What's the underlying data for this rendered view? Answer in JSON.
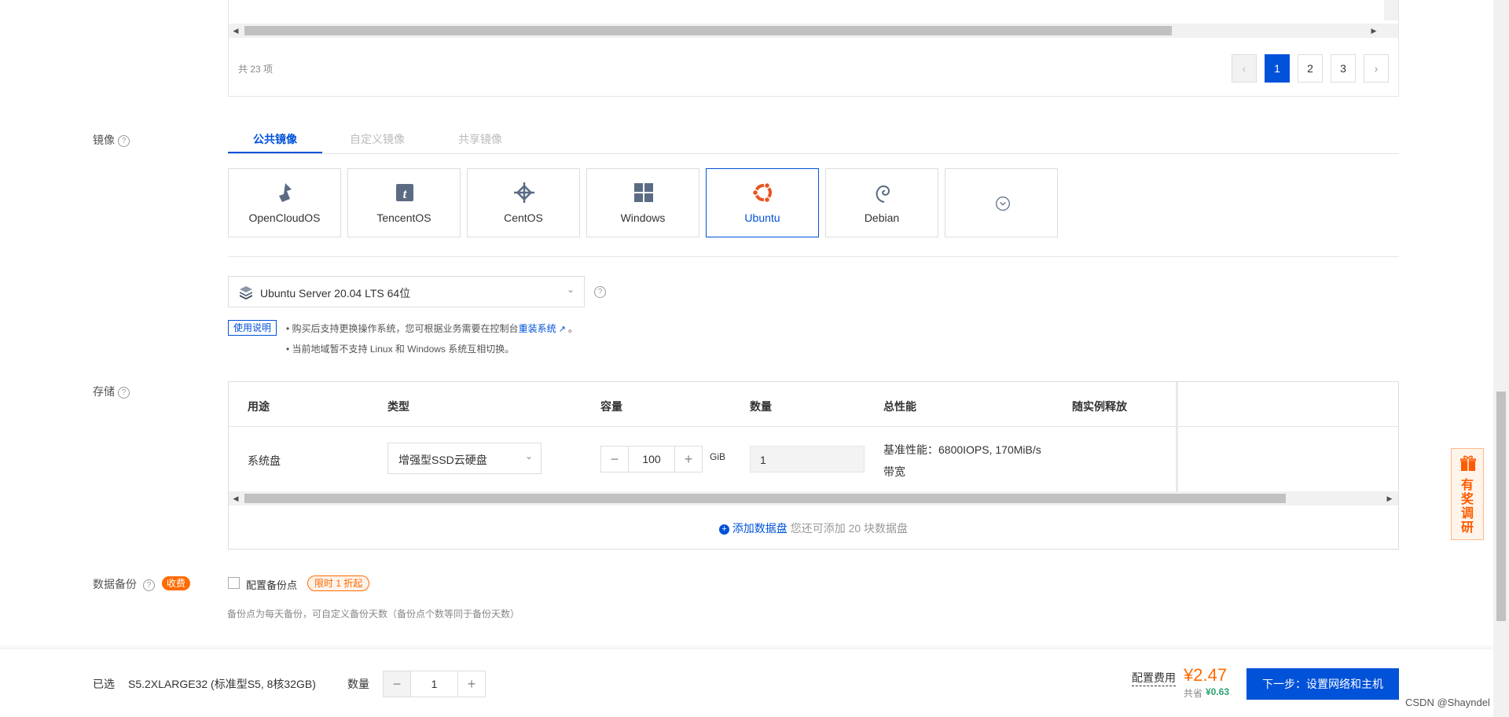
{
  "instance_table": {
    "total": "共 23 项",
    "pages": [
      "1",
      "2",
      "3"
    ],
    "current_page": "1"
  },
  "image": {
    "label": "镜像",
    "tabs": [
      "公共镜像",
      "自定义镜像",
      "共享镜像"
    ],
    "os_options": [
      "OpenCloudOS",
      "TencentOS",
      "CentOS",
      "Windows",
      "Ubuntu",
      "Debian"
    ],
    "selected_os": "Ubuntu",
    "version": "Ubuntu Server 20.04 LTS 64位",
    "usage_button": "使用说明",
    "note1": "购买后支持更换操作系统，您可根据业务需要在控制台",
    "note1_link": "重装系统",
    "note1_end": "。",
    "note2": "当前地域暂不支持 Linux 和 Windows 系统互相切换。"
  },
  "storage": {
    "label": "存储",
    "headers": [
      "用途",
      "类型",
      "容量",
      "数量",
      "总性能",
      "随实例释放"
    ],
    "row": {
      "usage": "系统盘",
      "type": "增强型SSD云硬盘",
      "capacity": "100",
      "unit": "GiB",
      "count": "1",
      "performance": "基准性能：6800IOPS, 170MiB/s",
      "performance2": "带宽"
    },
    "add_disk": "添加数据盘",
    "add_disk_hint": "您还可添加 20 块数据盘"
  },
  "backup": {
    "label": "数据备份",
    "fee_badge": "收费",
    "checkbox_label": "配置备份点",
    "promo": "限时 1 折起",
    "hint": "备份点为每天备份，可自定义备份天数（备份点个数等同于备份天数）"
  },
  "footer": {
    "selected_label": "已选",
    "selected_value": "S5.2XLARGE32 (标准型S5, 8核32GB)",
    "quantity_label": "数量",
    "quantity": "1",
    "fee_label": "配置费用",
    "price": "¥2.47",
    "saving_label": "共省",
    "saving": "¥0.63",
    "next_button": "下一步：设置网络和主机"
  },
  "side": {
    "survey": "有奖调研"
  },
  "watermark": "CSDN @Shayndel",
  "colors": {
    "brand": "#0052d9",
    "accent": "#ff6a00",
    "saving": "#2ba471"
  }
}
